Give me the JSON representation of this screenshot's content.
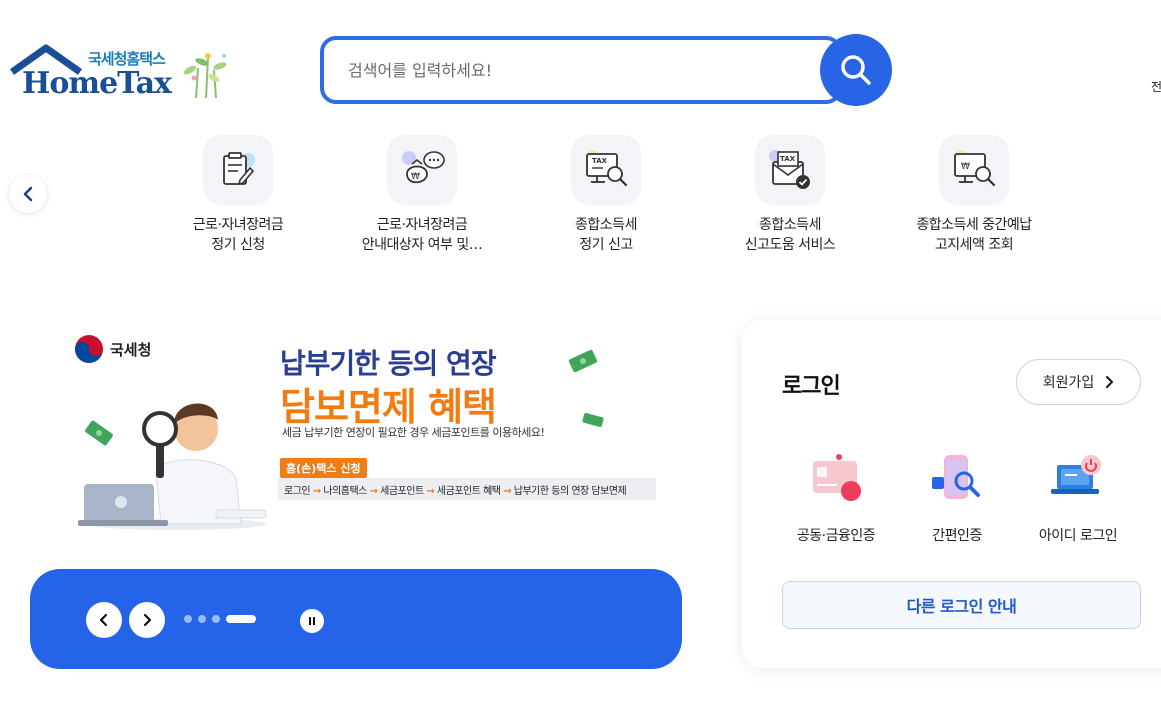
{
  "header": {
    "logo_kr": "국세청홈택스",
    "logo_en": "HomeTax",
    "search_placeholder": "검색어를 입력하세요!",
    "edge_text": "전"
  },
  "quick_menu": {
    "items": [
      {
        "line1": "근로·자녀장려금",
        "line2": "정기 신청",
        "icon": "application-form-icon"
      },
      {
        "line1": "근로·자녀장려금",
        "line2": "안내대상자 여부 및…",
        "icon": "money-bag-chat-icon"
      },
      {
        "line1": "종합소득세",
        "line2": "정기 신고",
        "icon": "tax-monitor-search-icon"
      },
      {
        "line1": "종합소득세",
        "line2": "신고도움 서비스",
        "icon": "tax-envelope-check-icon"
      },
      {
        "line1": "종합소득세 중간예납",
        "line2": "고지세액 조회",
        "icon": "monitor-search-icon"
      }
    ]
  },
  "banner": {
    "agency": "국세청",
    "title1": "납부기한 등의 연장",
    "title2": "담보면제 혜택",
    "subtitle": "세금 납부기한 연장이 필요한 경우 세금포인트를 이용하세요!",
    "tag": "홈(손)택스 신청",
    "path": [
      "로그인",
      "나의홈택스",
      "세금포인트",
      "세금포인트 혜택",
      "납부기한 등의 연장 담보면제"
    ],
    "arrow": "→",
    "slides_total": 4,
    "active_slide": 4
  },
  "login": {
    "title": "로그인",
    "signup": "회원가입",
    "options": [
      {
        "label": "공동·금융인증",
        "icon": "certificate-card-icon"
      },
      {
        "label": "간편인증",
        "icon": "simple-auth-phone-icon"
      },
      {
        "label": "아이디 로그인",
        "icon": "laptop-power-icon"
      }
    ],
    "other": "다른 로그인 안내"
  },
  "colors": {
    "primary": "#2865e6",
    "logo_blue": "#1a4f97",
    "banner_orange": "#f07c12",
    "banner_navy": "#2a3f94"
  }
}
